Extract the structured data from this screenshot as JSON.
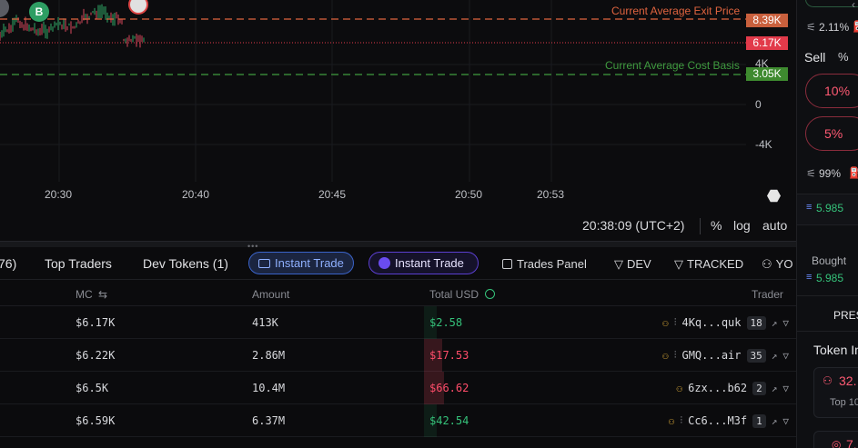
{
  "chart": {
    "exit_label": "Current Average Exit Price",
    "exit_value": "8.39K",
    "current_value": "6.17K",
    "cost_label": "Current Average Cost Basis",
    "cost_value": "3.05K",
    "y_ticks": [
      "4K",
      "0",
      "-4K"
    ],
    "x_ticks": [
      "20:30",
      "20:40",
      "20:45",
      "20:50",
      "20:53"
    ],
    "marker_b": "B",
    "time": "20:38:09 (UTC+2)",
    "pct": "%",
    "log": "log",
    "auto": "auto",
    "colors": {
      "exit": "#e0643f",
      "current": "#e23a4a",
      "cost": "#3f9b3f"
    }
  },
  "tabs": {
    "partial": "76)",
    "top_traders": "Top Traders",
    "dev_tokens": "Dev Tokens (1)",
    "instant_trade_1": "Instant Trade",
    "instant_trade_2": "Instant Trade",
    "trades_panel": "Trades Panel",
    "dev": "DEV",
    "tracked": "TRACKED",
    "you": "YO"
  },
  "table": {
    "headers": {
      "mc": "MC",
      "amount": "Amount",
      "total": "Total USD",
      "trader": "Trader"
    },
    "rows": [
      {
        "mc": "$6.17K",
        "amount": "413K",
        "usd": "$2.58",
        "side": "buy",
        "trader": "4Kq...quk",
        "count": "18"
      },
      {
        "mc": "$6.22K",
        "amount": "2.86M",
        "usd": "$17.53",
        "side": "sell",
        "trader": "GMQ...air",
        "count": "35"
      },
      {
        "mc": "$6.5K",
        "amount": "10.4M",
        "usd": "$66.62",
        "side": "sell",
        "trader": "6zx...b62",
        "count": "2"
      },
      {
        "mc": "$6.59K",
        "amount": "6.37M",
        "usd": "$42.54",
        "side": "buy",
        "trader": "Cc6...M3f",
        "count": "1"
      }
    ]
  },
  "right_panel": {
    "pct_a": "2.11%",
    "sell": "Sell",
    "pct_sym": "%",
    "p10": "10%",
    "p5": "5%",
    "pct_b": "99%",
    "sol_a": "5.985",
    "bought": "Bought",
    "sol_b": "5.985",
    "pres": "PRES",
    "token_info": "Token In",
    "holders": "32.",
    "top10": "Top 10",
    "bottom_num": "7."
  }
}
